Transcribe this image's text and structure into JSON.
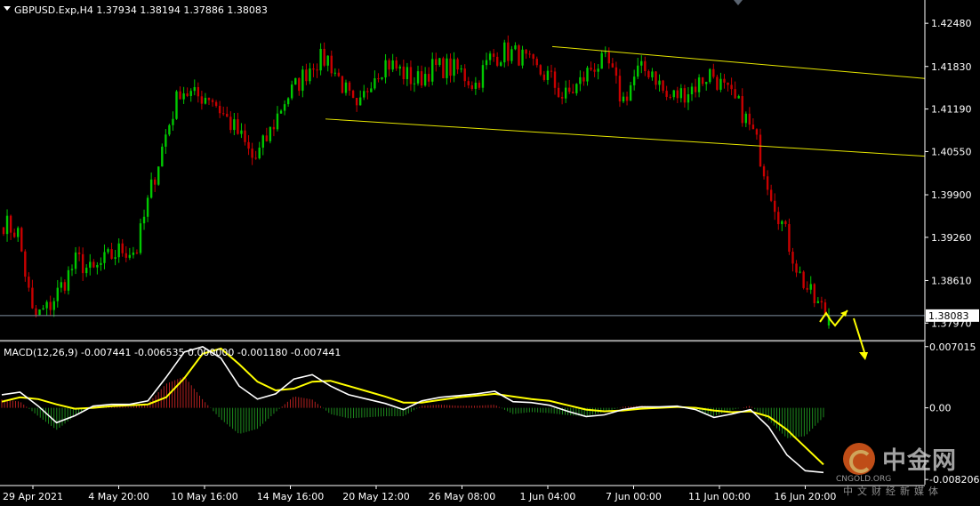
{
  "header": {
    "symbol_line": "GBPUSD.Exp,H4  1.37934 1.38194 1.37886 1.38083",
    "macd_line": "MACD(12,26,9) -0.007441 -0.006535 0.000000 -0.001180 -0.007441"
  },
  "current_price": "1.38083",
  "colors": {
    "background": "#000000",
    "bull_candle": "#00c800",
    "bear_candle": "#c80000",
    "axis": "#ffffff",
    "trendline": "#e6e600",
    "macd_main": "#ffffff",
    "macd_signal": "#ffff00",
    "hist_up": "#b42020",
    "hist_down": "#1e8c1e",
    "price_line": "#7f8fa0"
  },
  "icons": [
    "collapse-triangle-icon",
    "scroll-marker-icon",
    "arrow-annotation-icon"
  ],
  "watermark": {
    "brand": "中金网",
    "domain": "CNGOLD.ORG",
    "tagline": "中文财经新媒体"
  },
  "chart_data": [
    {
      "type": "candlestick",
      "title": "GBPUSD.Exp,H4",
      "ylim": [
        1.3772,
        1.4283
      ],
      "y_ticks": [
        "1.42480",
        "1.41830",
        "1.41190",
        "1.40550",
        "1.39900",
        "1.39260",
        "1.38610",
        "1.37970"
      ],
      "x_ticks": [
        "29 Apr 2021",
        "4 May 20:00",
        "10 May 16:00",
        "14 May 16:00",
        "20 May 12:00",
        "26 May 08:00",
        "1 Jun 04:00",
        "7 Jun 00:00",
        "11 Jun 00:00",
        "16 Jun 20:00"
      ],
      "close_path": [
        1.3948,
        1.3932,
        1.3805,
        1.3819,
        1.3855,
        1.3893,
        1.3872,
        1.3893,
        1.3908,
        1.3905,
        1.3998,
        1.408,
        1.415,
        1.4137,
        1.414,
        1.4108,
        1.408,
        1.404,
        1.408,
        1.413,
        1.4158,
        1.419,
        1.4195,
        1.4155,
        1.411,
        1.417,
        1.419,
        1.4175,
        1.416,
        1.418,
        1.4182,
        1.4175,
        1.4155,
        1.4195,
        1.4205,
        1.42,
        1.4178,
        1.4168,
        1.4135,
        1.4155,
        1.4185,
        1.4188,
        1.413,
        1.4175,
        1.4178,
        1.4135,
        1.4142,
        1.4155,
        1.4175,
        1.4145,
        1.412,
        1.4075,
        1.4,
        1.3935,
        1.387,
        1.383,
        1.3808
      ],
      "last": {
        "open": 1.37934,
        "high": 1.38194,
        "low": 1.37886,
        "close": 1.38083
      },
      "trendlines": [
        {
          "from": [
            "1 Jun",
            1.4213
          ],
          "to": [
            "right",
            1.4165
          ]
        },
        {
          "from": [
            "19 May",
            1.4104
          ],
          "to": [
            "right",
            1.4048
          ]
        }
      ],
      "horizontal_line": 1.38083
    },
    {
      "type": "line",
      "title": "MACD(12,26,9)",
      "values_in_title": [
        -0.007441,
        -0.006535,
        0.0,
        -0.00118,
        -0.007441
      ],
      "ylim": [
        -0.0088,
        0.0075
      ],
      "y_ticks": [
        "0.007015",
        "0.00",
        "-0.008206"
      ],
      "series": [
        {
          "name": "MACD",
          "values": [
            0.0015,
            0.0018,
            0.0002,
            -0.0017,
            -0.0009,
            0.0002,
            0.0004,
            0.0004,
            0.0008,
            0.0035,
            0.0064,
            0.007,
            0.0057,
            0.0025,
            0.001,
            0.0016,
            0.0033,
            0.0038,
            0.0025,
            0.0015,
            0.001,
            0.0005,
            -0.0002,
            0.0008,
            0.0012,
            0.0014,
            0.0016,
            0.0019,
            0.0007,
            0.0006,
            0.0003,
            -0.0004,
            -0.001,
            -0.0008,
            -0.0002,
            0.0001,
            0.0001,
            0.0002,
            -0.0002,
            -0.0011,
            -0.0007,
            -0.0002,
            -0.0022,
            -0.0054,
            -0.0072,
            -0.0074
          ]
        },
        {
          "name": "Signal",
          "values": [
            0.0007,
            0.0012,
            0.001,
            0.0004,
            -0.0001,
            0.0,
            0.0002,
            0.0003,
            0.0004,
            0.0012,
            0.0034,
            0.0062,
            0.0068,
            0.005,
            0.003,
            0.002,
            0.0022,
            0.003,
            0.0031,
            0.0025,
            0.0019,
            0.0013,
            0.0006,
            0.0006,
            0.0009,
            0.0012,
            0.0014,
            0.0016,
            0.0013,
            0.001,
            0.0008,
            0.0003,
            -0.0002,
            -0.0004,
            -0.0003,
            -0.0001,
            0.0,
            0.0001,
            0.0,
            -0.0003,
            -0.0005,
            -0.0004,
            -0.001,
            -0.0025,
            -0.0045,
            -0.0065
          ]
        }
      ]
    }
  ]
}
